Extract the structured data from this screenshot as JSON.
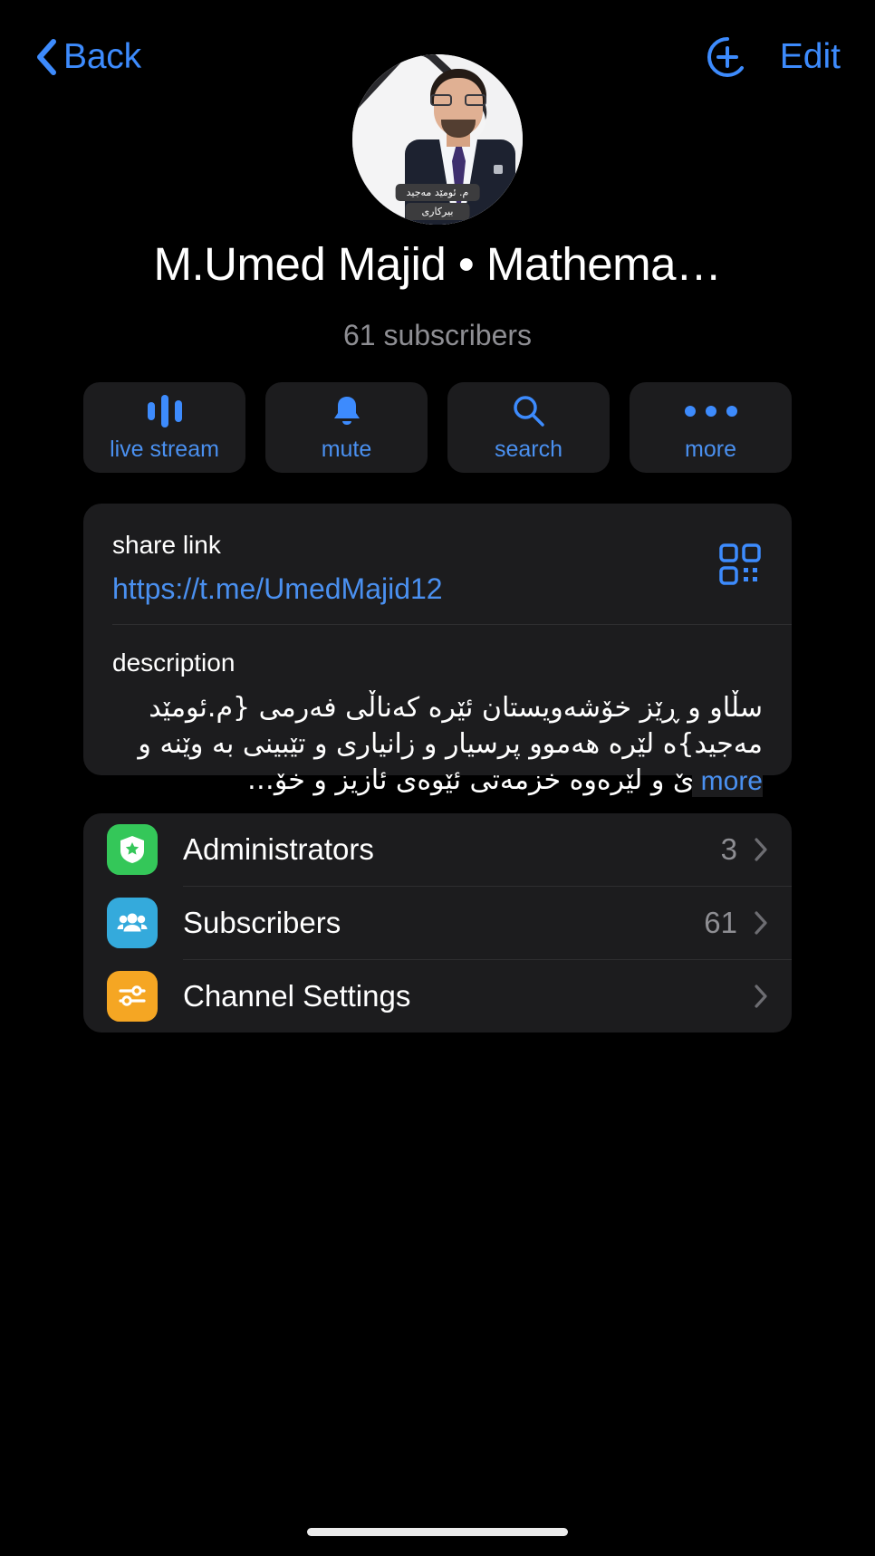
{
  "navbar": {
    "back_label": "Back",
    "edit_label": "Edit",
    "back_icon": "chevron-left-icon",
    "add_icon": "add-person-icon"
  },
  "profile": {
    "title": "M.Umed Majid • Mathema…",
    "subtitle": "61 subscribers",
    "avatar": {
      "badge_top": "م. ئومێد مەجید",
      "badge_bottom": "بیرکاری"
    }
  },
  "actions": [
    {
      "label": "live stream",
      "icon": "waveform-icon"
    },
    {
      "label": "mute",
      "icon": "bell-icon"
    },
    {
      "label": "search",
      "icon": "search-icon"
    },
    {
      "label": "more",
      "icon": "ellipsis-icon"
    }
  ],
  "share_link": {
    "label": "share link",
    "url": "https://t.me/UmedMajid12",
    "qr_icon": "qr-code-icon"
  },
  "description": {
    "label": "description",
    "text": "سڵاو و ڕێز خۆشەویستان ئێره کەناڵی فەرمی {م.ئومێد مەجید}ە لێره هەموو پرسیار و زانیاری و تێبینی به وێنه و دادەنرێ و لێرەوه خزمەتی ئێوەی ئازیز و خۆ…",
    "more_label": "more"
  },
  "settings_list": [
    {
      "label": "Administrators",
      "count": "3",
      "icon": "shield-badge-icon",
      "color": "#34c759"
    },
    {
      "label": "Subscribers",
      "count": "61",
      "icon": "people-icon",
      "color": "#34aadc"
    },
    {
      "label": "Channel Settings",
      "count": "",
      "icon": "sliders-icon",
      "color": "#f5a623"
    }
  ],
  "theme": {
    "accent": "#3d8bfd",
    "background": "#000000",
    "card": "#1c1c1e",
    "secondary_text": "#8e8e93"
  }
}
